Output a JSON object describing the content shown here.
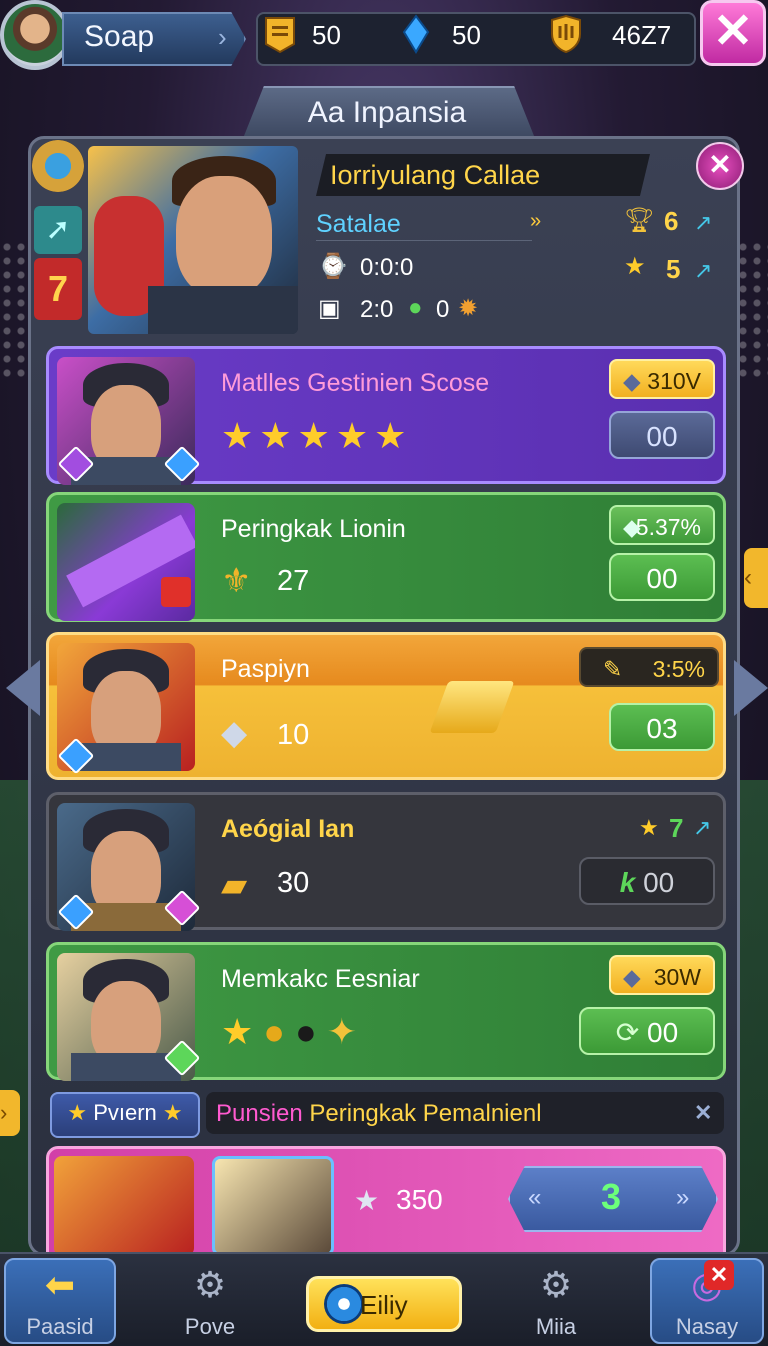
{
  "topbar": {
    "player_name": "Soap",
    "resources": [
      {
        "icon": "scroll-icon",
        "value": "50"
      },
      {
        "icon": "blue-crystal-icon",
        "value": "50"
      },
      {
        "icon": "gold-shield-icon",
        "value": "46Z7"
      }
    ],
    "close_label": "✕"
  },
  "title": "Aa Inpansia",
  "info": {
    "name": "Iorriyulang Callae",
    "subtitle": "Satalae",
    "row1_value": "0:0:0",
    "row2_value_a": "2:0",
    "row2_value_b": "0",
    "stat1": "6",
    "stat2": "5"
  },
  "cards": [
    {
      "title": "Matlles Gestinien Scose",
      "badge": "310V",
      "button": "00",
      "color_title": "#ff9bd9"
    },
    {
      "title": "Peringkak Lionin",
      "badge": "5.37%",
      "button": "00",
      "stat": "27"
    },
    {
      "title": "Paspiyn",
      "badge": "3:5%",
      "button": "03",
      "stat": "10"
    },
    {
      "title": "Aeógial Ian",
      "stat_right": "7",
      "button_prefix": "k",
      "button": "00",
      "stat": "30"
    },
    {
      "title": "Memkakc Eesniar",
      "badge": "30W",
      "button": "00"
    }
  ],
  "promo": {
    "tag": "Pvıern",
    "text_pink": "Punsien",
    "text_yellow": "Peringkak Pemalnienl"
  },
  "bottom_card": {
    "value": "350",
    "button": "3"
  },
  "nav": [
    {
      "label": "Paasid"
    },
    {
      "label": "Pove"
    },
    {
      "label": "Eiliy"
    },
    {
      "label": "Miia"
    },
    {
      "label": "Nasay"
    }
  ],
  "colors": {
    "accent_gold": "#ffd54a",
    "accent_cyan": "#5fd2ff",
    "card_purple": "#6a3cc8",
    "card_green": "#3f9a44",
    "card_orange": "#f2a63a",
    "card_dark": "#35363d",
    "card_pink": "#d23fa8"
  }
}
